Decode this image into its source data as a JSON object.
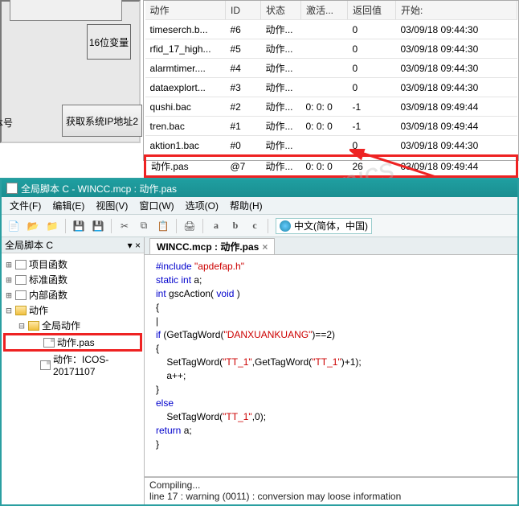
{
  "topLeft": {
    "frameSmallLabel": "16位变量",
    "rowLabel": "本号",
    "grayButton": "获取系统IP地址2"
  },
  "table": {
    "headers": {
      "action": "动作",
      "id": "ID",
      "status": "状态",
      "trigger": "激活...",
      "ret": "返回值",
      "start": "开始:"
    },
    "rows": [
      {
        "action": "timeserch.b...",
        "id": "#6",
        "status": "动作...",
        "trigger": "",
        "ret": "0",
        "start": "03/09/18 09:44:30"
      },
      {
        "action": "rfid_17_high...",
        "id": "#5",
        "status": "动作...",
        "trigger": "",
        "ret": "0",
        "start": "03/09/18 09:44:30"
      },
      {
        "action": "alarmtimer....",
        "id": "#4",
        "status": "动作...",
        "trigger": "",
        "ret": "0",
        "start": "03/09/18 09:44:30"
      },
      {
        "action": "dataexplort...",
        "id": "#3",
        "status": "动作...",
        "trigger": "",
        "ret": "0",
        "start": "03/09/18 09:44:30"
      },
      {
        "action": "qushi.bac",
        "id": "#2",
        "status": "动作...",
        "trigger": "0: 0: 0",
        "ret": "-1",
        "start": "03/09/18 09:49:44"
      },
      {
        "action": "tren.bac",
        "id": "#1",
        "status": "动作...",
        "trigger": "0: 0: 0",
        "ret": "-1",
        "start": "03/09/18 09:49:44"
      },
      {
        "action": "aktion1.bac",
        "id": "#0",
        "status": "动作...",
        "trigger": "",
        "ret": "0",
        "start": "03/09/18 09:44:30"
      },
      {
        "action": "动作.pas",
        "id": "@7",
        "status": "动作...",
        "trigger": "0: 0: 0",
        "ret": "26",
        "start": "03/09/18 09:49:44"
      }
    ]
  },
  "editor": {
    "title": "全局脚本 C - WINCC.mcp : 动作.pas",
    "menu": {
      "file": "文件(F)",
      "edit": "编辑(E)",
      "view": "视图(V)",
      "window": "窗口(W)",
      "options": "选项(O)",
      "help": "帮助(H)"
    },
    "langCombo": "中文(简体，中国)",
    "sidebarTitle": "全局脚本 C",
    "tree": {
      "projFn": "项目函数",
      "stdFn": "标准函数",
      "intFn": "内部函数",
      "actions": "动作",
      "globalAct": "全局动作",
      "pasFile": "动作.pas",
      "icosAct": "动作：ICOS-20171107"
    },
    "tabLabel": "WINCC.mcp : 动作.pas",
    "tabClose": "×",
    "code": {
      "l1a": "#include ",
      "l1b": "\"apdefap.h\"",
      "l2a": "static",
      "l2b": " int",
      "l2c": " a;",
      "l3a": "int",
      "l3b": " gscAction( ",
      "l3c": "void",
      "l3d": " )",
      "l4": "{",
      "l5a": "if",
      "l5b": " (GetTagWord(",
      "l5c": "\"DANXUANKUANG\"",
      "l5d": ")==2)",
      "l6": "{",
      "l7a": "    SetTagWord(",
      "l7b": "\"TT_1\"",
      "l7c": ",GetTagWord(",
      "l7d": "\"TT_1\"",
      "l7e": ")+1);",
      "l8": "    a++;",
      "l9": "}",
      "l10a": "else",
      "l11a": "    SetTagWord(",
      "l11b": "\"TT_1\"",
      "l11c": ",0);",
      "l12a": "return",
      "l12b": " a;",
      "l13": "}"
    },
    "status": {
      "l1": "Compiling...",
      "l2": "line 17 : warning (0011) : conversion may loose information"
    }
  },
  "watermark": "找答案 onics"
}
